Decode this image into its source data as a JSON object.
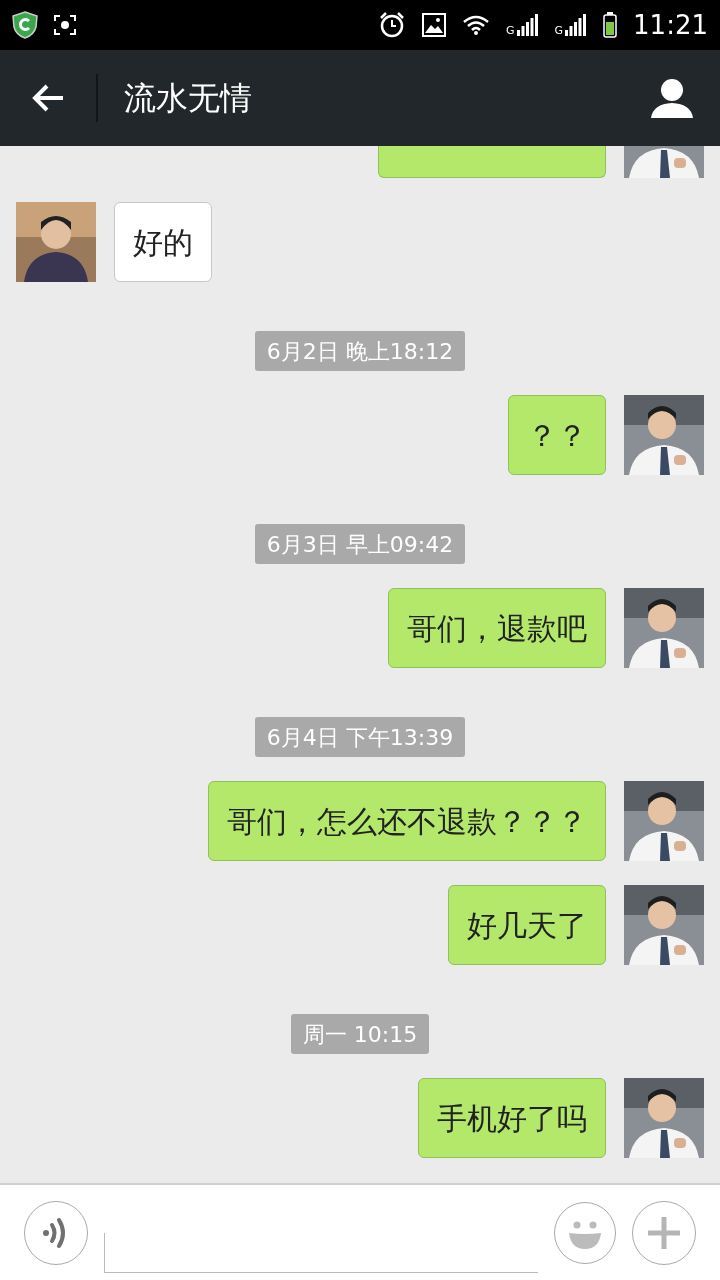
{
  "status_bar": {
    "signals": [
      {
        "label": "G"
      },
      {
        "label": "G"
      }
    ],
    "time": "11:21"
  },
  "header": {
    "title": "流水无情"
  },
  "messages": [
    {
      "kind": "received",
      "text": "好的"
    },
    {
      "kind": "time",
      "text": "6月2日 晚上18:12"
    },
    {
      "kind": "sent",
      "text": "？？"
    },
    {
      "kind": "time",
      "text": "6月3日 早上09:42"
    },
    {
      "kind": "sent",
      "text": "哥们，退款吧"
    },
    {
      "kind": "time",
      "text": "6月4日 下午13:39"
    },
    {
      "kind": "sent",
      "text": "哥们，怎么还不退款？？？"
    },
    {
      "kind": "sent",
      "text": "好几天了"
    },
    {
      "kind": "time",
      "text": "周一 10:15"
    },
    {
      "kind": "sent",
      "text": "手机好了吗"
    }
  ]
}
